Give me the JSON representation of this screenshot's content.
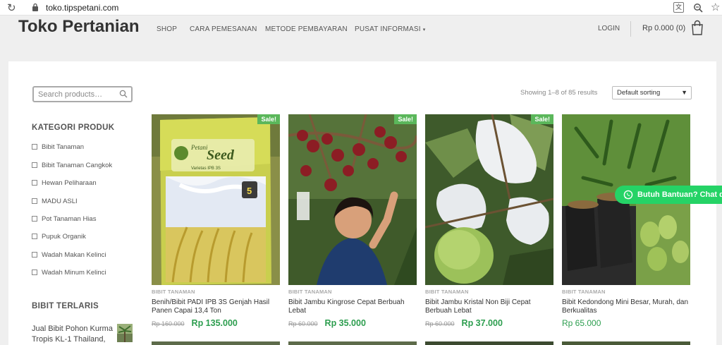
{
  "browser": {
    "url": "toko.tipspetani.com",
    "translate_label": "文"
  },
  "header": {
    "logo": "Toko Pertanian",
    "nav": [
      "SHOP",
      "CARA PEMESANAN",
      "METODE PEMBAYARAN",
      "PUSAT INFORMASI"
    ],
    "nav_dropdown_caret": "▾",
    "login": "LOGIN",
    "cart_total": "Rp 0.000 (0)"
  },
  "search": {
    "placeholder": "Search products…"
  },
  "sidebar": {
    "categories_heading": "KATEGORI PRODUK",
    "categories": [
      "Bibit Tanaman",
      "Bibit Tanaman Cangkok",
      "Hewan Peliharaan",
      "MADU ASLI",
      "Pot Tanaman Hias",
      "Pupuk Organik",
      "Wadah Makan Kelinci",
      "Wadah Minum Kelinci"
    ],
    "bestseller_heading": "BIBIT TERLARIS",
    "bestseller_item": "Jual Bibit Pohon Kurma Tropis KL-1 Thailand,"
  },
  "toolbar": {
    "results_text": "Showing 1–8 of 85 results",
    "sort_selected": "Default sorting"
  },
  "products": [
    {
      "sale_badge": "Sale!",
      "category": "BIBIT TANAMAN",
      "title": "Benih/Bibit PADI IPB 3S Genjah Hasil Panen Capai 13,4 Ton",
      "old_price": "Rp 160.000",
      "price": "Rp 135.000",
      "package_brand": "Petani",
      "package_word": "Seed",
      "package_variety": "Varietas IPB 3S",
      "package_weight": "5"
    },
    {
      "sale_badge": "Sale!",
      "category": "BIBIT TANAMAN",
      "title": "Bibit Jambu Kingrose Cepat Berbuah Lebat",
      "old_price": "Rp 60.000",
      "price": "Rp 35.000"
    },
    {
      "sale_badge": "Sale!",
      "category": "BIBIT TANAMAN",
      "title": "Bibit Jambu Kristal Non Biji Cepat Berbuah Lebat",
      "old_price": "Rp 60.000",
      "price": "Rp 37.000"
    },
    {
      "category": "BIBIT TANAMAN",
      "title": "Bibit Kedondong Mini Besar, Murah, dan Berkualitas",
      "price": "Rp 65.000"
    }
  ],
  "whatsapp": {
    "label": "Butuh Bantuan? Chat di"
  },
  "colors": {
    "price_green": "#2d9e4f",
    "sale_badge": "#5bb75b",
    "whatsapp": "#25d366"
  }
}
